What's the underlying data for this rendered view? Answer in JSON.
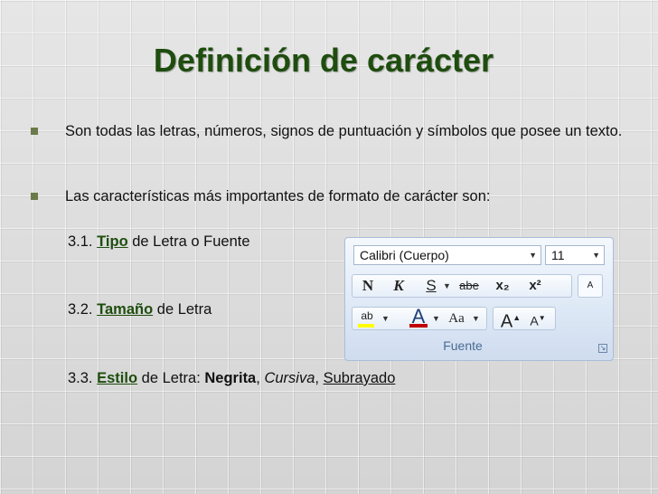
{
  "slide": {
    "title": "Definición de carácter",
    "bullets": [
      "Son todas las letras, números, signos de puntuación y símbolos que posee un texto.",
      "Las características más importantes de formato de carácter son:"
    ],
    "items": [
      {
        "num": "3.1.",
        "keyword": "Tipo",
        "rest": "de Letra o Fuente"
      },
      {
        "num": "3.2.",
        "keyword": "Tamaño",
        "rest": "de Letra"
      },
      {
        "num": "3.3.",
        "keyword": "Estilo",
        "rest": "de Letra:",
        "bold": "Negrita",
        "sep1": ",",
        "italic": "Cursiva",
        "sep2": ",",
        "underline": "Subrayado"
      }
    ]
  },
  "ribbon": {
    "font_name": "Calibri (Cuerpo)",
    "font_size": "11",
    "bold_btn": "N",
    "italic_btn": "K",
    "underline_btn": "S",
    "strike_btn": "abe",
    "sub_btn": "x₂",
    "sup_btn": "x²",
    "highlight_btn": "ab",
    "color_btn": "A",
    "case_btn": "Aa",
    "grow_btn": "A",
    "shrink_btn": "A",
    "clear_btn": "A",
    "group_label": "Fuente"
  },
  "colors": {
    "title": "#1e4d0e",
    "bullet_marker": "#6b7a4a",
    "font_color_bar": "#c00000",
    "highlight_bar": "#ffff00"
  }
}
